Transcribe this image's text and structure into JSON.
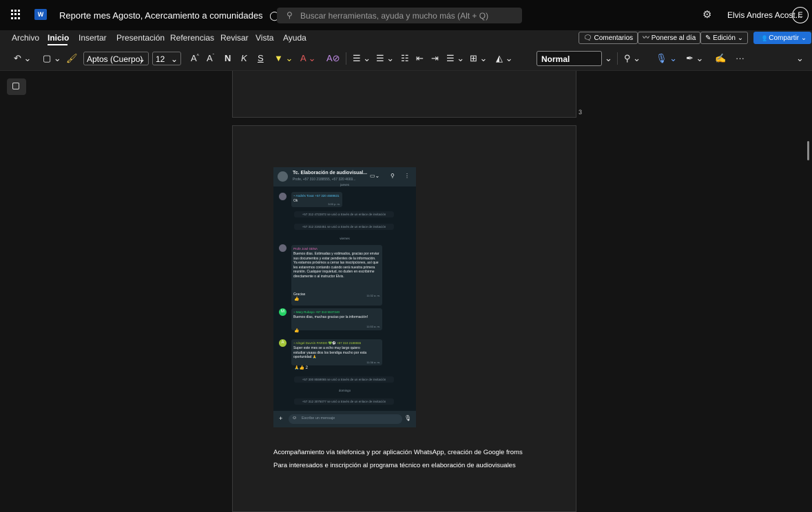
{
  "titlebar": {
    "doc_title": "Reporte mes Agosto, Acercamiento a comunidades",
    "search_placeholder": "Buscar herramientas, ayuda y mucho más (Alt + Q)",
    "user_name": "Elvis Andres Acost...",
    "avatar_initial": "E"
  },
  "menu": {
    "items": [
      "Archivo",
      "Inicio",
      "Insertar",
      "Presentación",
      "Referencias",
      "Revisar",
      "Vista",
      "Ayuda"
    ],
    "active": "Inicio",
    "comentarios": "Comentarios",
    "ponerse": "Ponerse al día",
    "edicion": "Edición",
    "compartir": "Compartir"
  },
  "toolbar": {
    "font_name": "Aptos (Cuerpo)",
    "font_size": "12",
    "bold": "N",
    "italic": "K",
    "underline": "S",
    "style": "Normal",
    "more": "···"
  },
  "pages": {
    "page_number": "3"
  },
  "whatsapp": {
    "group_title": "Tc. Elaboración de audiovisual...",
    "group_subtitle": "Profe, +57 310 2188555, +57 320 4669...",
    "day1": "jueves",
    "msg1_sender": "~ Andrés Tovar +57 320 4669631",
    "msg1_text": "Ok",
    "msg1_time": "3:00 p. m.",
    "sys1": "+57 312 4722872 se unió a través de un enlace de invitación",
    "sys2": "+57 312 3192451 se unió a través de un enlace de invitación",
    "day2": "viernes",
    "msg2_sender": "Profe José SENA",
    "msg2_text": "Buenos días. Estimadas y estimados, gracias por enviar sus documentos y estar pendientes de la información. Ya estamos próximos a cerrar las inscripciones, así que les estaremos contando cuándo será nuestra primera reunión. Cualquier inquietud, no duden en escribirme directamente o al instructor Elvis.",
    "msg2_text2": "Gracias",
    "msg2_time": "11:32 a. m.",
    "msg3_sender": "~ Mary Rubayo +57 313 5537240",
    "msg3_text": "Buenos días, muchas gracias por la información!",
    "msg3_time": "11:53 a. m.",
    "msg4_sender": "~ A/ngel DuvA/n PARDO 💚⚽ +57 310 2188555",
    "msg4_text": "Super este mes se a echo muy largo quiero estudiar yaaaa dios los bendiga mucho por esta oportunidad 🙏",
    "msg4_time": "11:36 a. m.",
    "msg4_reactions": "🙏👍 2",
    "sys3": "+57 300 8559065 se unió a través de un enlace de invitación",
    "day3": "domingo",
    "sys4": "+57 312 3075077 se unió a través de un enlace de invitación",
    "input_placeholder": "Escribe un mensaje"
  },
  "body": {
    "caption1": "Acompañamiento vía telefonica y por aplicación WhatsApp, creación de Google froms",
    "caption2": "Para interesados e inscripción al programa técnico en elaboración de audiovisuales"
  }
}
